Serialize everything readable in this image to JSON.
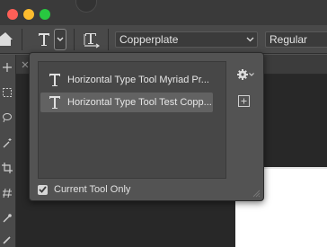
{
  "titlebar": {
    "buttons": [
      "close",
      "minimize",
      "zoom"
    ],
    "colors": {
      "close": "#fe5f57",
      "minimize": "#fdbc2e",
      "zoom": "#28c840"
    }
  },
  "options_bar": {
    "home_icon": "home-icon",
    "tool_icon": "horizontal-type-icon",
    "orientation_icon": "text-orientation-icon",
    "font_family": "Copperplate",
    "font_style": "Regular"
  },
  "preset_picker": {
    "items": [
      {
        "label": "Horizontal Type Tool Myriad Pr...",
        "selected": false
      },
      {
        "label": "Horizontal Type Tool Test Copp...",
        "selected": true
      }
    ],
    "gear_icon": "gear-icon",
    "new_preset_icon": "new-preset-icon",
    "current_tool_only_label": "Current Tool Only",
    "current_tool_only_checked": true
  },
  "colors": {
    "ui_bg": "#535353",
    "options_bar": "#494949",
    "titlebar": "#3a3a3a",
    "list_bg": "#474747",
    "selection": "#626262",
    "canvas": "#ffffff"
  }
}
